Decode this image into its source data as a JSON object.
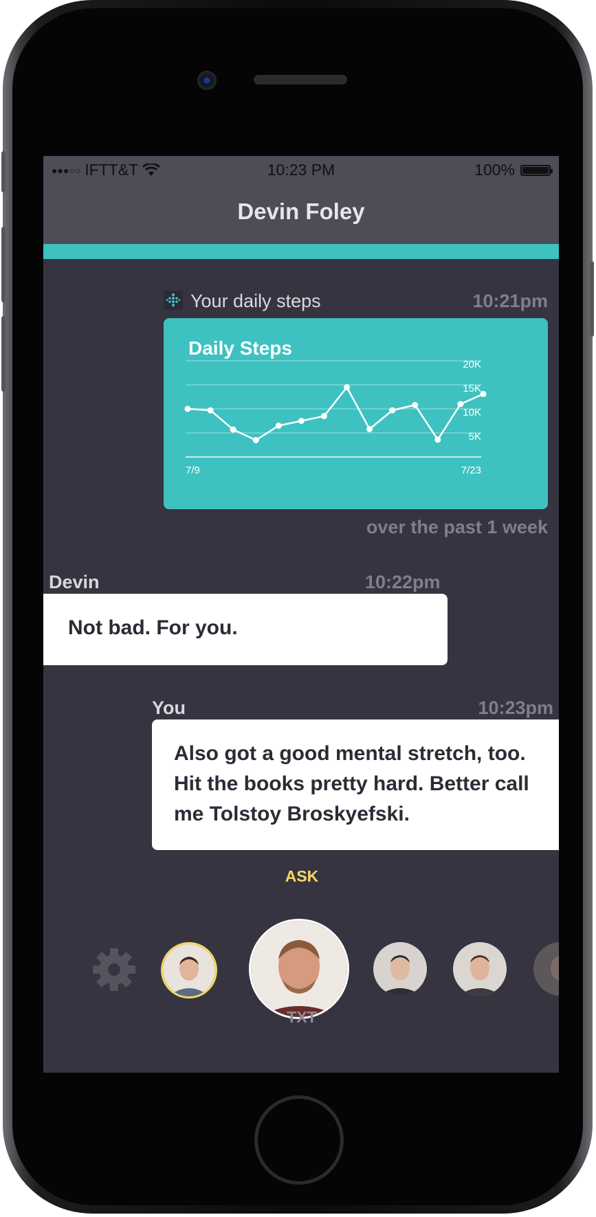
{
  "status_bar": {
    "carrier": "IFTT&T",
    "time": "10:23 PM",
    "battery": "100%"
  },
  "nav": {
    "title": "Devin Foley"
  },
  "messages": {
    "steps": {
      "label": "Your daily steps",
      "time": "10:21pm",
      "footnote": "over the past 1 week",
      "icon": "fitbit-icon"
    },
    "devin": {
      "sender": "Devin",
      "time": "10:22pm",
      "text": "Not bad. For you."
    },
    "you": {
      "sender": "You",
      "time": "10:23pm",
      "text": "Also got a good mental stretch, too. Hit the books pretty hard. Better call me Tolstoy Broskyefski."
    }
  },
  "chart_data": {
    "type": "line",
    "title": "Daily Steps",
    "x_labels": [
      "7/9",
      "7/23"
    ],
    "y_ticks": [
      "20K",
      "15K",
      "10K",
      "5K"
    ],
    "ylim": [
      0,
      20000
    ],
    "values": [
      10000,
      9700,
      5700,
      3500,
      6500,
      7500,
      8500,
      14500,
      5800,
      9700,
      10800,
      3600,
      11000,
      13100
    ],
    "grid": true,
    "colors": {
      "line": "#ffffff",
      "card": "#3ec1c1"
    }
  },
  "contacts_bar": {
    "ask_label": "ASK",
    "txt_label": "TXT",
    "settings_icon": "gear-icon",
    "accent_color": "#f6d860"
  }
}
